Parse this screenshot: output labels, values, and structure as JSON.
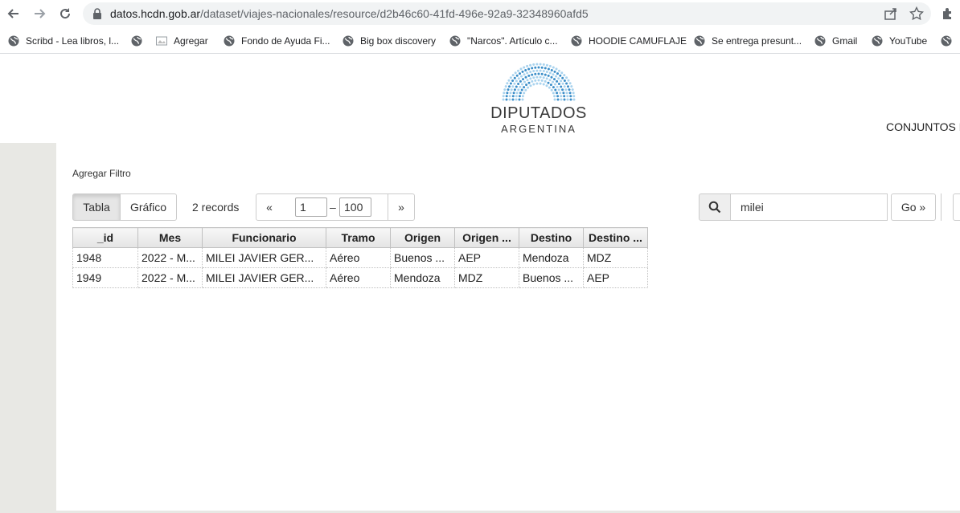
{
  "browser": {
    "url_host": "datos.hcdn.gob.ar",
    "url_path": "/dataset/viajes-nacionales/resource/d2b46c60-41fd-496e-92a9-32348960afd5",
    "bookmarks": [
      {
        "label": "Scribd - Lea libros, l...",
        "icon": "globe-icon"
      },
      {
        "label": "",
        "icon": "globe-icon"
      },
      {
        "label": "Agregar",
        "icon": "image-icon"
      },
      {
        "label": "Fondo de Ayuda Fi...",
        "icon": "globe-icon"
      },
      {
        "label": "Big box discovery",
        "icon": "globe-icon"
      },
      {
        "label": "\"Narcos\". Artículo c...",
        "icon": "globe-icon"
      },
      {
        "label": "HOODIE CAMUFLAJE",
        "icon": "globe-icon"
      },
      {
        "label": "Se entrega presunt...",
        "icon": "globe-icon"
      },
      {
        "label": "Gmail",
        "icon": "globe-icon"
      },
      {
        "label": "YouTube",
        "icon": "globe-icon"
      }
    ]
  },
  "header": {
    "logo_title": "DIPUTADOS",
    "logo_subtitle": "ARGENTINA",
    "nav_conjuntos": "CONJUNTOS D"
  },
  "toolbar": {
    "add_filter": "Agregar Filtro",
    "tab_table": "Tabla",
    "tab_chart": "Gráfico",
    "records": "2 records",
    "prev": "«",
    "next": "»",
    "page_from": "1",
    "page_dash": "–",
    "page_to": "100",
    "search_value": "milei",
    "go_label": "Go »"
  },
  "table": {
    "columns": [
      "_id",
      "Mes",
      "Funcionario",
      "Tramo",
      "Origen",
      "Origen ...",
      "Destino",
      "Destino ..."
    ],
    "rows": [
      [
        "1948",
        "2022 - M...",
        "MILEI JAVIER GER...",
        "Aéreo",
        "Buenos ...",
        "AEP",
        "Mendoza",
        "MDZ"
      ],
      [
        "1949",
        "2022 - M...",
        "MILEI JAVIER GER...",
        "Aéreo",
        "Mendoza",
        "MDZ",
        "Buenos ...",
        "AEP"
      ]
    ]
  },
  "colors": {
    "logo_blue": "#3d8fc9",
    "logo_light": "#a9d3ee",
    "sidebar_gray": "#e8e8e4"
  }
}
